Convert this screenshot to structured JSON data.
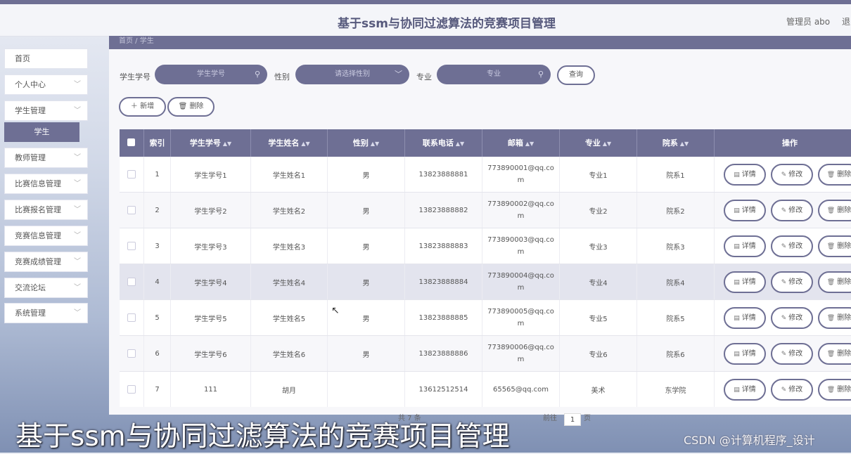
{
  "header": {
    "title": "基于ssm与协同过滤算法的竞赛项目管理",
    "admin": "管理员 abo",
    "logout": "退"
  },
  "sidebar": {
    "items": [
      {
        "label": "首页",
        "chevron": false
      },
      {
        "label": "个人中心",
        "chevron": true
      },
      {
        "label": "学生管理",
        "chevron": true
      },
      {
        "label": "教师管理",
        "chevron": true
      },
      {
        "label": "比赛信息管理",
        "chevron": true
      },
      {
        "label": "比赛报名管理",
        "chevron": true
      },
      {
        "label": "竞赛信息管理",
        "chevron": true
      },
      {
        "label": "竞赛成绩管理",
        "chevron": true
      },
      {
        "label": "交流论坛",
        "chevron": true
      },
      {
        "label": "系统管理",
        "chevron": true
      }
    ],
    "active_sub": "学生"
  },
  "breadcrumb": "首页 / 学生",
  "search": {
    "student_no_label": "学生学号",
    "student_no_placeholder": "学生学号",
    "gender_label": "性别",
    "gender_placeholder": "请选择性别",
    "major_label": "专业",
    "major_placeholder": "专业",
    "query_button": "查询"
  },
  "toolbar": {
    "add": "新增",
    "delete": "删除"
  },
  "table": {
    "headers": [
      "索引",
      "学生学号",
      "学生姓名",
      "性别",
      "联系电话",
      "邮箱",
      "专业",
      "院系",
      "操作"
    ],
    "rows": [
      {
        "idx": "1",
        "no": "学生学号1",
        "name": "学生姓名1",
        "gender": "男",
        "phone": "13823888881",
        "email": "773890001@qq.com",
        "major": "专业1",
        "dept": "院系1"
      },
      {
        "idx": "2",
        "no": "学生学号2",
        "name": "学生姓名2",
        "gender": "男",
        "phone": "13823888882",
        "email": "773890002@qq.com",
        "major": "专业2",
        "dept": "院系2"
      },
      {
        "idx": "3",
        "no": "学生学号3",
        "name": "学生姓名3",
        "gender": "男",
        "phone": "13823888883",
        "email": "773890003@qq.com",
        "major": "专业3",
        "dept": "院系3"
      },
      {
        "idx": "4",
        "no": "学生学号4",
        "name": "学生姓名4",
        "gender": "男",
        "phone": "13823888884",
        "email": "773890004@qq.com",
        "major": "专业4",
        "dept": "院系4"
      },
      {
        "idx": "5",
        "no": "学生学号5",
        "name": "学生姓名5",
        "gender": "男",
        "phone": "13823888885",
        "email": "773890005@qq.com",
        "major": "专业5",
        "dept": "院系5"
      },
      {
        "idx": "6",
        "no": "学生学号6",
        "name": "学生姓名6",
        "gender": "男",
        "phone": "13823888886",
        "email": "773890006@qq.com",
        "major": "专业6",
        "dept": "院系6"
      },
      {
        "idx": "7",
        "no": "111",
        "name": "胡月",
        "gender": "",
        "phone": "13612512514",
        "email": "65565@qq.com",
        "major": "美术",
        "dept": "东学院"
      }
    ],
    "actions": {
      "detail": "详情",
      "edit": "修改",
      "delete": "删除"
    }
  },
  "pager": {
    "total": "共 7 条",
    "goto": "前往",
    "page": "1",
    "unit": "页"
  },
  "caption": "基于ssm与协同过滤算法的竞赛项目管理",
  "watermark": "CSDN @计算机程序_设计",
  "colors": {
    "accent": "#6e6f94"
  }
}
